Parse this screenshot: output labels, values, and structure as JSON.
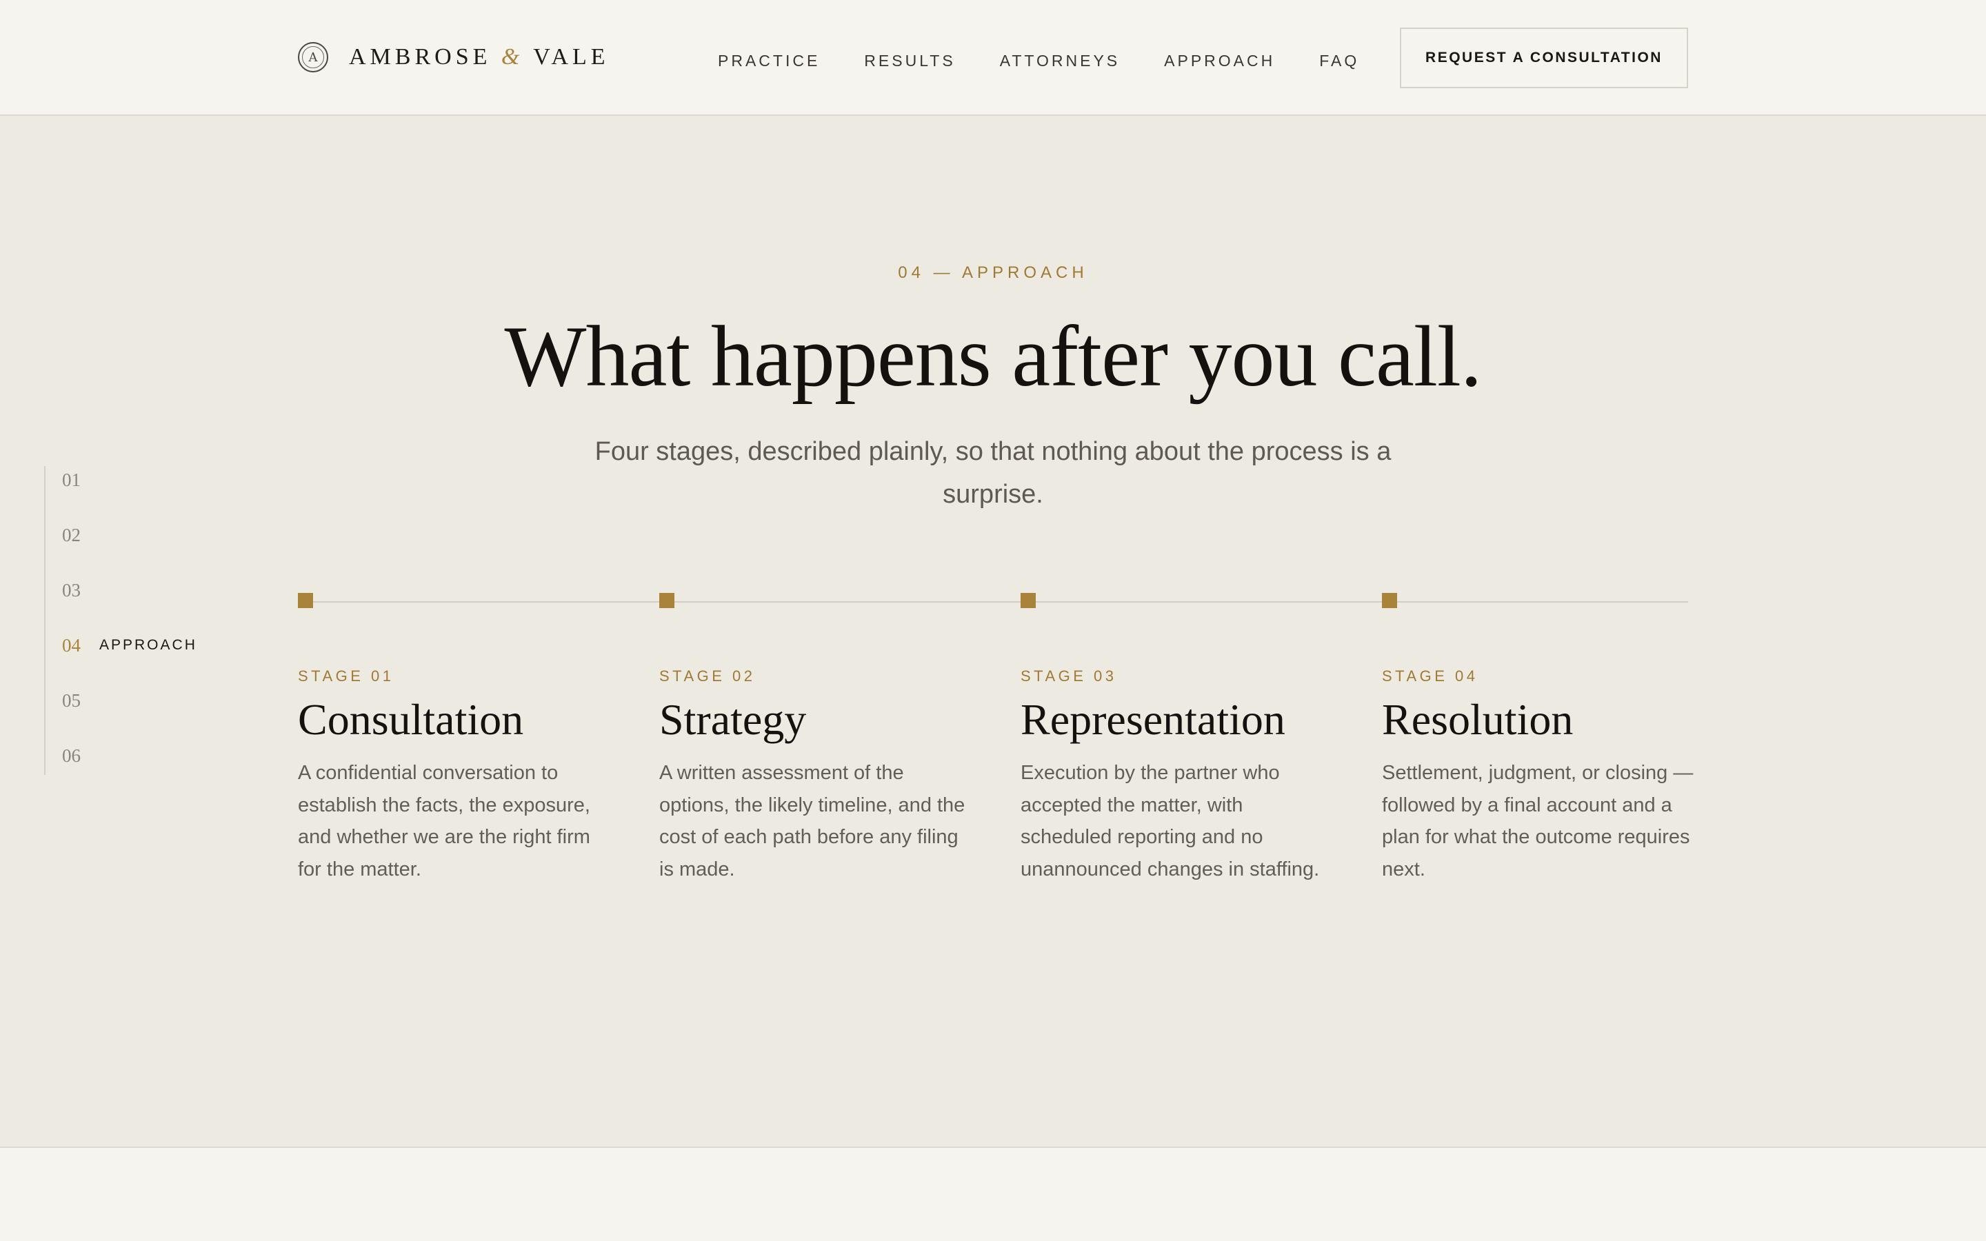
{
  "progress": {
    "fraction": 0.373
  },
  "header": {
    "brand": {
      "mark_letter": "A",
      "name_part1": "AMBROSE ",
      "ampersand": "&",
      "name_part2": " VALE"
    },
    "nav": [
      {
        "label": "PRACTICE"
      },
      {
        "label": "RESULTS"
      },
      {
        "label": "ATTORNEYS"
      },
      {
        "label": "APPROACH"
      },
      {
        "label": "FAQ"
      }
    ],
    "cta_label": "REQUEST A CONSULTATION"
  },
  "rail": {
    "items": [
      {
        "num": "01",
        "label": ""
      },
      {
        "num": "02",
        "label": ""
      },
      {
        "num": "03",
        "label": ""
      },
      {
        "num": "04",
        "label": "APPROACH"
      },
      {
        "num": "05",
        "label": ""
      },
      {
        "num": "06",
        "label": ""
      }
    ],
    "active_index": 3
  },
  "section": {
    "eyebrow": "04 — APPROACH",
    "headline": "What happens after you call.",
    "subhead": "Four stages, described plainly, so that nothing about the process is a surprise."
  },
  "stages": [
    {
      "label": "STAGE 01",
      "title": "Consultation",
      "body": "A confidential conversation to establish the facts, the exposure, and whether we are the right firm for the matter."
    },
    {
      "label": "STAGE 02",
      "title": "Strategy",
      "body": "A written assessment of the options, the likely timeline, and the cost of each path before any filing is made."
    },
    {
      "label": "STAGE 03",
      "title": "Representation",
      "body": "Execution by the partner who accepted the matter, with scheduled reporting and no unannounced changes in staffing."
    },
    {
      "label": "STAGE 04",
      "title": "Resolution",
      "body": "Settlement, judgment, or closing — followed by a final account and a plan for what the outcome requires next."
    }
  ],
  "colors": {
    "accent": "#a9833a",
    "background": "#edeae2",
    "header_bg": "#f6f4ef",
    "text_dark": "#14110e",
    "text_muted": "#625d55"
  }
}
